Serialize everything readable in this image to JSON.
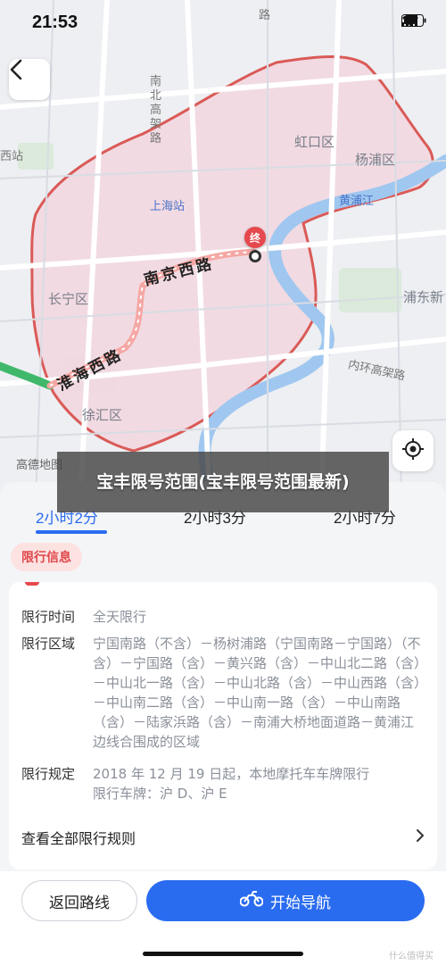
{
  "status_bar": {
    "time": "21:53"
  },
  "map": {
    "districts": {
      "hongkou": "虹口区",
      "yangpu": "杨浦区",
      "changning": "长宁区",
      "xuhui": "徐汇区",
      "pudong": "浦东新",
      "shanghai_station": "上海站",
      "xi_station": "西站"
    },
    "roads": {
      "nanbei": "南北高架路",
      "huangpu_river": "黄浦江",
      "inner_ring": "内环高架路",
      "nanjing_west": "南京西路",
      "huaihai_west": "淮海西路",
      "top_road": "路"
    },
    "end_marker": "终",
    "watermark": "高德地图"
  },
  "title_overlay": "宝丰限号范围(宝丰限号范围最新)",
  "route_tabs": [
    {
      "label": "2小时2分",
      "active": true
    },
    {
      "label": "2小时3分",
      "active": false
    },
    {
      "label": "2小时7分",
      "active": false
    }
  ],
  "restriction_badge": "限行信息",
  "restriction": {
    "time_key": "限行时间",
    "time_value": "全天限行",
    "area_key": "限行区域",
    "area_value": "宁国南路（不含）－杨树浦路（宁国南路－宁国路）（不含）－宁国路（含）－黄兴路（含）－中山北二路（含）－中山北一路（含）－中山北路（含）－中山西路（含）－中山南二路（含）－中山南一路（含）－中山南路（含）－陆家浜路（含）－南浦大桥地面道路－黄浦江边线合围成的区域",
    "rule_key": "限行规定",
    "rule_value_line1": "2018 年 12 月 19 日起，本地摩托车车牌限行",
    "rule_value_line2": "限行车牌：沪 D、沪 E"
  },
  "rules_link": "查看全部限行规则",
  "actions": {
    "back_route": "返回路线",
    "start_nav": "开始导航"
  },
  "corner_watermark": "什么值得买"
}
